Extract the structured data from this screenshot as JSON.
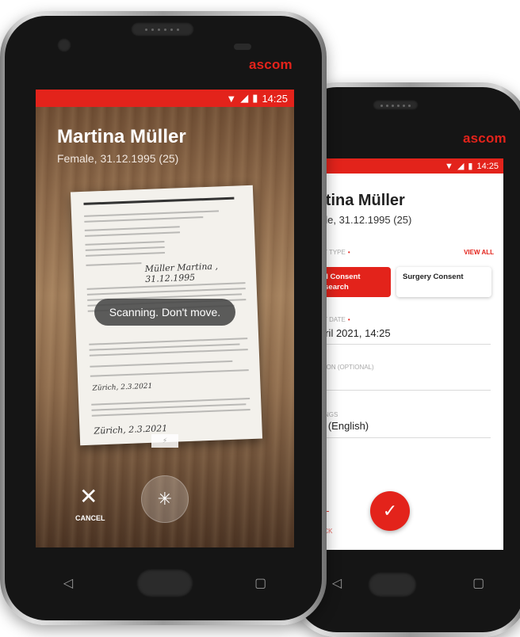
{
  "brand": "ascom",
  "colors": {
    "accent": "#e3231b",
    "text_dark": "#222222",
    "muted": "#aaaaaa"
  },
  "front_phone": {
    "status": {
      "time": "14:25",
      "icons": [
        "wifi-icon",
        "signal-icon",
        "battery-icon"
      ]
    },
    "patient": {
      "name": "Martina Müller",
      "details": "Female, 31.12.1995 (25)"
    },
    "document": {
      "handwriting_1": "Müller  Martina , 31.12.1995",
      "handwriting_2": "Zürich, 2.3.2021",
      "handwriting_3": "Zürich, 2.3.2021"
    },
    "scanning_message": "Scanning. Don't move.",
    "cancel_label": "CANCEL",
    "nav_icons": [
      "back-icon",
      "home-icon",
      "recents-icon"
    ]
  },
  "back_phone": {
    "status": {
      "time": "14:25"
    },
    "patient": {
      "name": "rtina Müller",
      "details": "ale, 31.12.1995 (25)"
    },
    "consent_type_label": "ENT TYPE",
    "view_all": "VIEW ALL",
    "chips": [
      {
        "label": "eral Consent Research",
        "selected": true
      },
      {
        "label": "Surgery Consent",
        "selected": false
      }
    ],
    "date_label": "ENT DATE",
    "date_value": "pril 2021, 14:25",
    "description_label": "IPTION (OPTIONAL)",
    "settings_label": "TTINGS",
    "settings_value": "e (English)",
    "back_label": "ACK",
    "confirm_icon": "check-icon"
  }
}
